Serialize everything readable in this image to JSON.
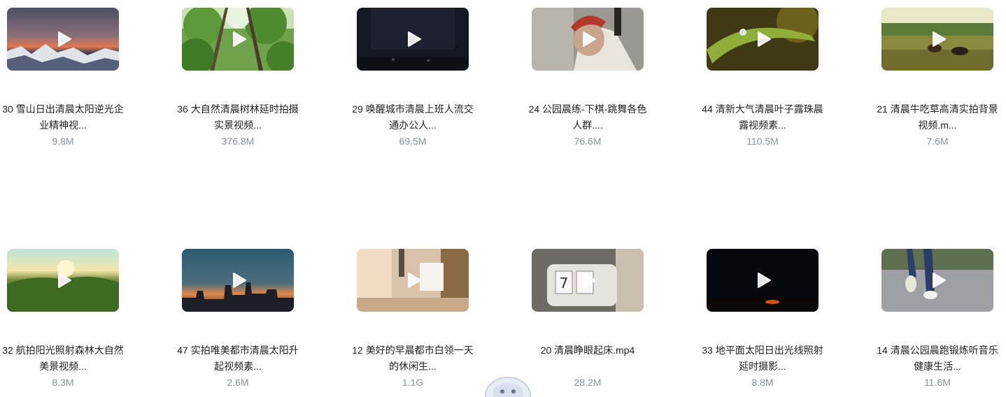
{
  "videos": [
    {
      "title": "30 雪山日出清晨太阳逆光企业精神视...",
      "size": "9.8M",
      "thumb": "snowy-mountain-sunrise"
    },
    {
      "title": "36 大自然清晨树林延时拍摄实景视频...",
      "size": "376.8M",
      "thumb": "forest-canopy"
    },
    {
      "title": "29 唤醒城市清晨上班人流交通办公人...",
      "size": "69.5M",
      "thumb": "dark-city"
    },
    {
      "title": "24 公园晨练-下棋-跳舞各色人群....",
      "size": "76.6M",
      "thumb": "man-red-cap"
    },
    {
      "title": "44 清新大气清晨叶子露珠晨露视频素...",
      "size": "110.5M",
      "thumb": "leaf-dewdrop"
    },
    {
      "title": "21 清晨牛吃草高清实拍背景视频.m...",
      "size": "7.6M",
      "thumb": "cattle-grazing"
    },
    {
      "title": "32 航拍阳光照射森林大自然美景视频...",
      "size": "8.3M",
      "thumb": "sunlit-forest-aerial"
    },
    {
      "title": "47 实拍唯美都市清晨太阳升起视频素...",
      "size": "2.6M",
      "thumb": "city-skyline-sunrise"
    },
    {
      "title": "12 美好的早晨都市白领一天的休闲生...",
      "size": "1.1G",
      "thumb": "bedroom-morning"
    },
    {
      "title": "20 清晨睁眼起床.mp4",
      "size": "28.2M",
      "thumb": "flip-clock"
    },
    {
      "title": "33 地平面太阳日出光线照射延时摄影...",
      "size": "8.8M",
      "thumb": "horizon-sunrise"
    },
    {
      "title": "14 清晨公园晨跑锻炼听音乐健康生活...",
      "size": "11.6M",
      "thumb": "jogger-feet"
    }
  ],
  "icons": {
    "play": "play-icon",
    "mascot": "mascot-icon"
  },
  "colors": {
    "title_text": "#222222",
    "size_text": "#8a8f99",
    "play_icon": "#ffffff"
  }
}
